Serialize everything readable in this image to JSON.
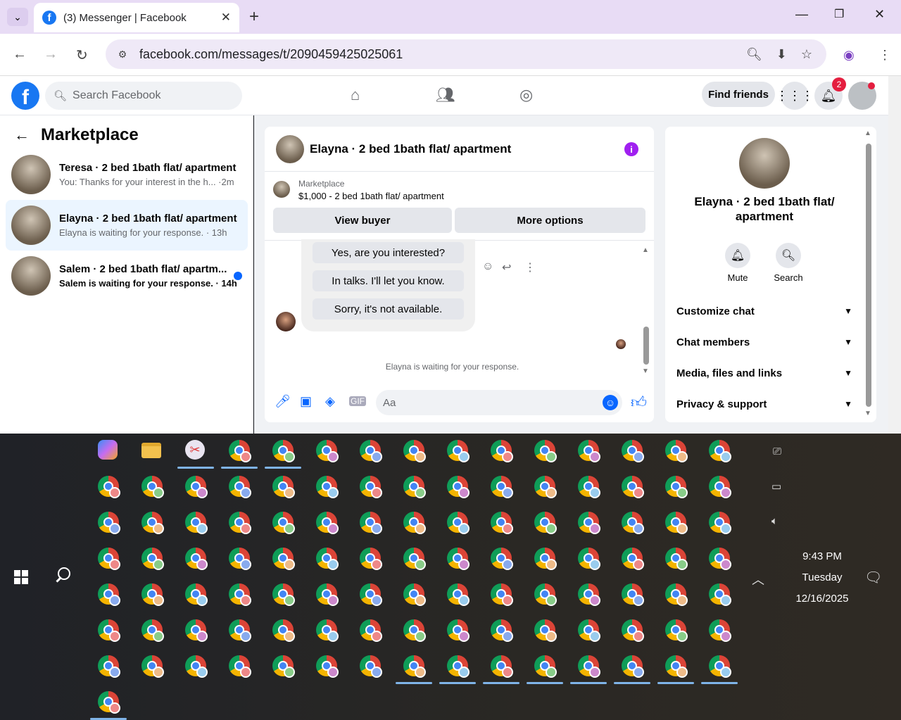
{
  "browser": {
    "tab_title": "(3) Messenger | Facebook",
    "tab_favicon": "f",
    "tab_close": "✕",
    "new_tab": "+",
    "url": "facebook.com/messages/t/2090459425025061"
  },
  "facebook": {
    "logo": "f",
    "search_placeholder": "Search Facebook",
    "find_friends": "Find friends",
    "notification_count": "2"
  },
  "sidebar": {
    "title": "Marketplace",
    "conversations": [
      {
        "name": "Teresa · 2 bed 1bath flat/ apartment",
        "preview": "You: Thanks for your interest in the h... ·2m"
      },
      {
        "name": "Elayna · 2 bed 1bath flat/ apartment",
        "preview": "Elayna is waiting for your response. · 13h"
      },
      {
        "name": "Salem · 2 bed 1bath flat/ apartm...",
        "preview": "Salem is waiting for your response. · 14h"
      }
    ]
  },
  "chat": {
    "header_name": "Elayna · 2 bed 1bath flat/ apartment",
    "info_icon": "i",
    "listing_source": "Marketplace",
    "listing": "$1,000 - 2 bed 1bath flat/ apartment",
    "view_buyer": "View buyer",
    "more_options": "More options",
    "quick_replies": [
      "Yes, are you interested?",
      "In talks. I'll let you know.",
      "Sorry, it's not available."
    ],
    "waiting_text": "Elayna is waiting for your response.",
    "composer_placeholder": "Aa"
  },
  "details": {
    "name": "Elayna · 2 bed 1bath flat/ apartment",
    "mute_label": "Mute",
    "search_label": "Search",
    "sections": [
      "Customize chat",
      "Chat members",
      "Media, files and links",
      "Privacy & support"
    ]
  },
  "taskbar": {
    "time": "9:43 PM",
    "day": "Tuesday",
    "date": "12/16/2025"
  },
  "colors": {
    "accent": "#0866ff",
    "fb_blue": "#1877f2",
    "tab_bg": "#e8dcf5",
    "info_purple": "#a020f0"
  }
}
